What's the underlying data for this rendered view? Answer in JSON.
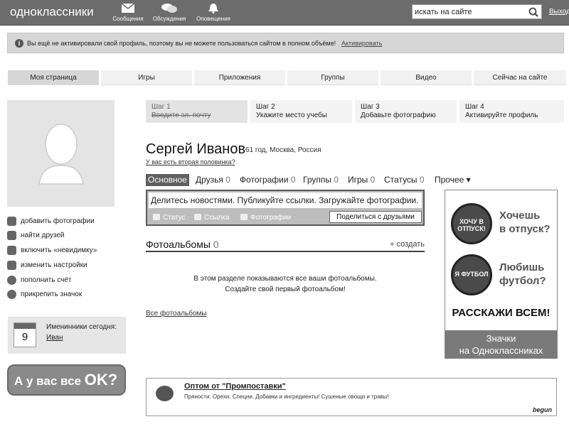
{
  "header": {
    "logo": "одноклассники",
    "nav": [
      {
        "label": "Сообщения",
        "icon": "envelope-icon"
      },
      {
        "label": "Обсуждения",
        "icon": "chat-bubbles-icon"
      },
      {
        "label": "Оповещения",
        "icon": "bell-icon"
      }
    ],
    "search_value": "искать на сайте",
    "exit_label": "Выход"
  },
  "notice": {
    "text": "Вы ещё не активировали свой профиль, поэтому вы не можете пользоваться сайтом в полном объёме!",
    "link": "Активировать"
  },
  "main_tabs": [
    {
      "label": "Моя страница",
      "active": true
    },
    {
      "label": "Игры"
    },
    {
      "label": "Приложения"
    },
    {
      "label": "Группы"
    },
    {
      "label": "Видео"
    },
    {
      "label": "Сейчас на сайте"
    }
  ],
  "left_menu": [
    {
      "label": "добавить фотографии",
      "icon": "photo-icon"
    },
    {
      "label": "найти друзей",
      "icon": "friends-icon"
    },
    {
      "label": "включить «невидимку»",
      "icon": "invisible-icon"
    },
    {
      "label": "изменить настройки",
      "icon": "wrench-icon"
    },
    {
      "label": "пополнить счёт",
      "icon": "coin-icon"
    },
    {
      "label": "прикрепить значок",
      "icon": "badge-icon"
    }
  ],
  "birthdays": {
    "day": "9",
    "title": "Именинники сегодня:",
    "name": "Иван"
  },
  "ok_banner": {
    "text": "А у вас все",
    "ok": "OK?"
  },
  "steps": [
    {
      "num": "Шаг 1",
      "text": "Введите эл. почту",
      "done": true
    },
    {
      "num": "Шаг 2",
      "text": "Укажите место учебы"
    },
    {
      "num": "Шаг 3",
      "text": "Добавьте фотографию"
    },
    {
      "num": "Шаг 4",
      "text": "Активируйте профиль"
    }
  ],
  "profile": {
    "name": "Сергей Иванов",
    "info": "61 год, Москва, Россия",
    "partner_link": "У вас есть вторая половинка?"
  },
  "profile_tabs": [
    {
      "label": "Основное",
      "active": true
    },
    {
      "label": "Друзья",
      "count": "0"
    },
    {
      "label": "Фотографии",
      "count": "0"
    },
    {
      "label": "Группы",
      "count": "0"
    },
    {
      "label": "Игры",
      "count": "0"
    },
    {
      "label": "Статусы",
      "count": "0"
    },
    {
      "label": "Прочее ▾"
    }
  ],
  "share": {
    "placeholder": "Делитесь новостями. Публикуйте ссылки. Загружайте фотографии.",
    "options": [
      "Статус",
      "Ссылка",
      "Фотографии"
    ],
    "button": "Поделиться с друзьями"
  },
  "albums": {
    "title": "Фотоальбомы",
    "count": "0",
    "create": "+ создать",
    "message_line1": "В этом разделе показываются все ваши фотоальбомы.",
    "message_line2": "Создайте свой первый фотоальбом!",
    "all_link": "Все фотоальбомы"
  },
  "promo": {
    "badge1": "ХОЧУ В ОТПУСК!",
    "q1_line1": "Хочешь",
    "q1_line2": "в отпуск?",
    "badge2": "Я ФУТБОЛ",
    "q2_line1": "Любишь",
    "q2_line2": "футбол?",
    "tell": "РАССКАЖИ ВСЕМ!",
    "footer_line1": "Значки",
    "footer_line2": "на Одноклассниках"
  },
  "ad": {
    "title": "Оптом от \"Промпоставки\"",
    "desc": "Пряности. Орехи. Специи. Добавки и ингредиенты! Сушеные овощи и травы!",
    "brand": "begun"
  }
}
